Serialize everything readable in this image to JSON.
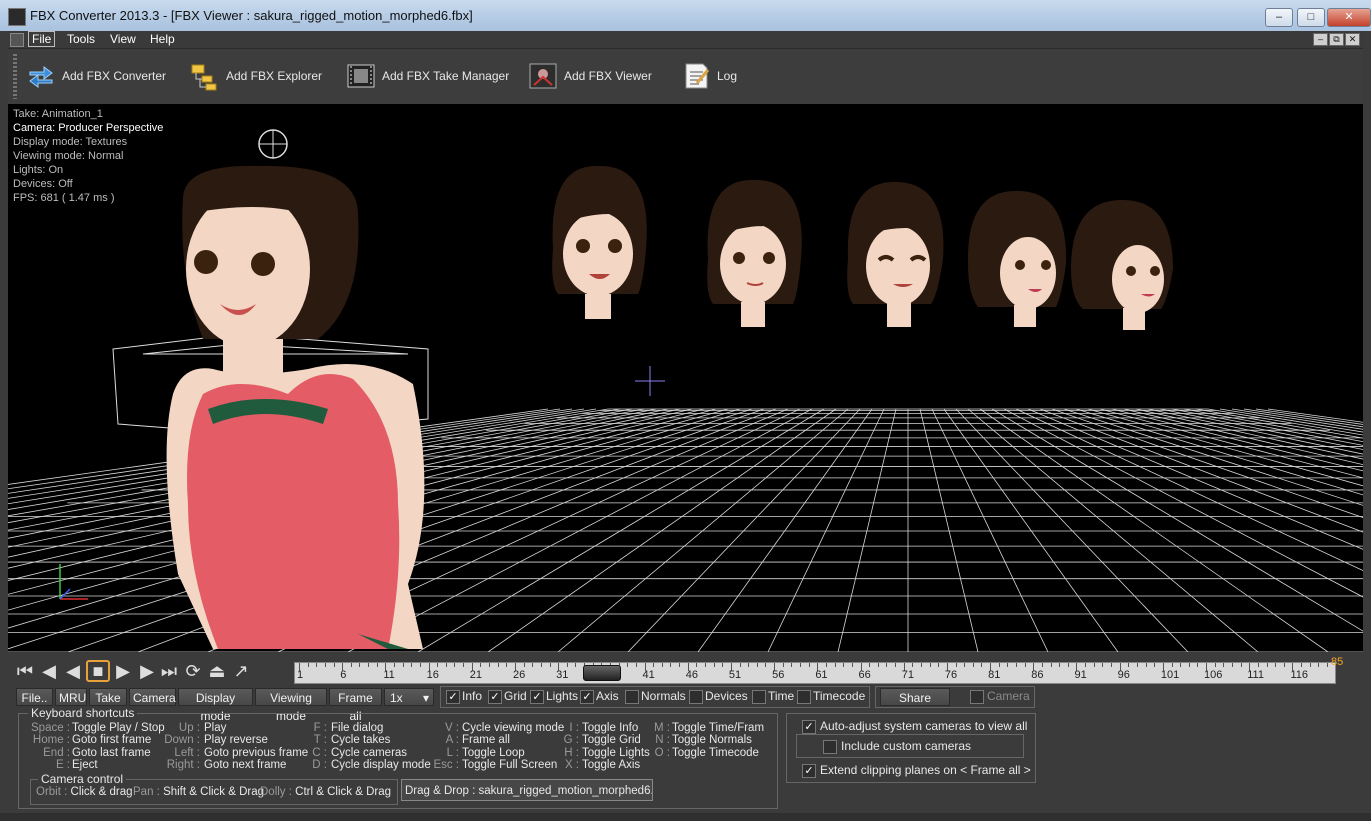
{
  "window": {
    "title": "FBX Converter 2013.3 - [FBX Viewer : sakura_rigged_motion_morphed6.fbx]"
  },
  "menu": [
    "File",
    "Tools",
    "View",
    "Help"
  ],
  "toolbar": [
    {
      "label": "Add FBX Converter",
      "icon": "converter-arrows-icon"
    },
    {
      "label": "Add FBX Explorer",
      "icon": "folder-tree-icon"
    },
    {
      "label": "Add FBX Take Manager",
      "icon": "film-strip-icon"
    },
    {
      "label": "Add FBX Viewer",
      "icon": "viewer-icon"
    },
    {
      "label": "Log",
      "icon": "log-notepad-icon"
    }
  ],
  "info": {
    "take": "Take: Animation_1",
    "camera": "Camera: Producer Perspective",
    "display": "Display mode: Textures",
    "viewing": "Viewing mode: Normal",
    "lights": "Lights: On",
    "devices": "Devices: Off",
    "fps": "FPS: 681 ( 1.47 ms )"
  },
  "timeline": {
    "labels": [
      "1",
      "6",
      "11",
      "16",
      "21",
      "26",
      "31",
      "36",
      "41",
      "46",
      "51",
      "56",
      "61",
      "66",
      "71",
      "76",
      "81",
      "86",
      "91",
      "96",
      "101",
      "106",
      "111",
      "116"
    ],
    "end_frame": "85",
    "current_frame": 36
  },
  "buttons": {
    "file": "File..",
    "mru": "MRU",
    "take": "Take",
    "camera": "Camera",
    "display_mode": "Display mode",
    "viewing_mode": "Viewing mode",
    "frame_all": "Frame all",
    "speed": "1x",
    "share": "Share"
  },
  "toggles": [
    {
      "label": "Info",
      "checked": true
    },
    {
      "label": "Grid",
      "checked": true
    },
    {
      "label": "Lights",
      "checked": true
    },
    {
      "label": "Axis",
      "checked": true
    },
    {
      "label": "Normals",
      "checked": false
    },
    {
      "label": "Devices",
      "checked": false
    },
    {
      "label": "Time",
      "checked": false
    },
    {
      "label": "Timecode",
      "checked": false
    }
  ],
  "camera_toggle": {
    "label": "Camera",
    "checked": false
  },
  "shortcuts": {
    "title": "Keyboard shortcuts",
    "col1": [
      {
        "k": "Space :",
        "v": "Toggle Play / Stop"
      },
      {
        "k": "Home :",
        "v": "Goto first frame"
      },
      {
        "k": "End :",
        "v": "Goto last frame"
      },
      {
        "k": "E :",
        "v": "Eject"
      }
    ],
    "col2": [
      {
        "k": "Up :",
        "v": "Play"
      },
      {
        "k": "Down :",
        "v": "Play reverse"
      },
      {
        "k": "Left :",
        "v": "Goto previous frame"
      },
      {
        "k": "Right :",
        "v": "Goto next frame"
      }
    ],
    "col3": [
      {
        "k": "F :",
        "v": "File dialog"
      },
      {
        "k": "T :",
        "v": "Cycle takes"
      },
      {
        "k": "C :",
        "v": "Cycle cameras"
      },
      {
        "k": "D :",
        "v": "Cycle display mode"
      }
    ],
    "col4": [
      {
        "k": "V :",
        "v": "Cycle viewing mode"
      },
      {
        "k": "A :",
        "v": "Frame all"
      },
      {
        "k": "L :",
        "v": "Toggle Loop"
      },
      {
        "k": "Esc :",
        "v": "Toggle Full Screen"
      }
    ],
    "col5": [
      {
        "k": "I :",
        "v": "Toggle Info"
      },
      {
        "k": "G :",
        "v": "Toggle Grid"
      },
      {
        "k": "H :",
        "v": "Toggle Lights"
      },
      {
        "k": "X :",
        "v": "Toggle Axis"
      }
    ],
    "col6": [
      {
        "k": "M :",
        "v": "Toggle Time/Fram"
      },
      {
        "k": "N :",
        "v": "Toggle Normals"
      },
      {
        "k": "O :",
        "v": "Toggle Timecode"
      }
    ]
  },
  "camera_control": {
    "title": "Camera control",
    "orbit": {
      "k": "Orbit :",
      "v": "Click & drag"
    },
    "pan": {
      "k": "Pan :",
      "v": "Shift & Click & Drag"
    },
    "dolly": {
      "k": "Dolly :",
      "v": "Ctrl & Click & Drag"
    }
  },
  "drag_drop": "Drag & Drop : sakura_rigged_motion_morphed6.fbx",
  "options": {
    "auto_adjust": "Auto-adjust system cameras to view all",
    "include_custom": "Include custom cameras",
    "extend_clipping": "Extend clipping planes on < Frame all >"
  }
}
